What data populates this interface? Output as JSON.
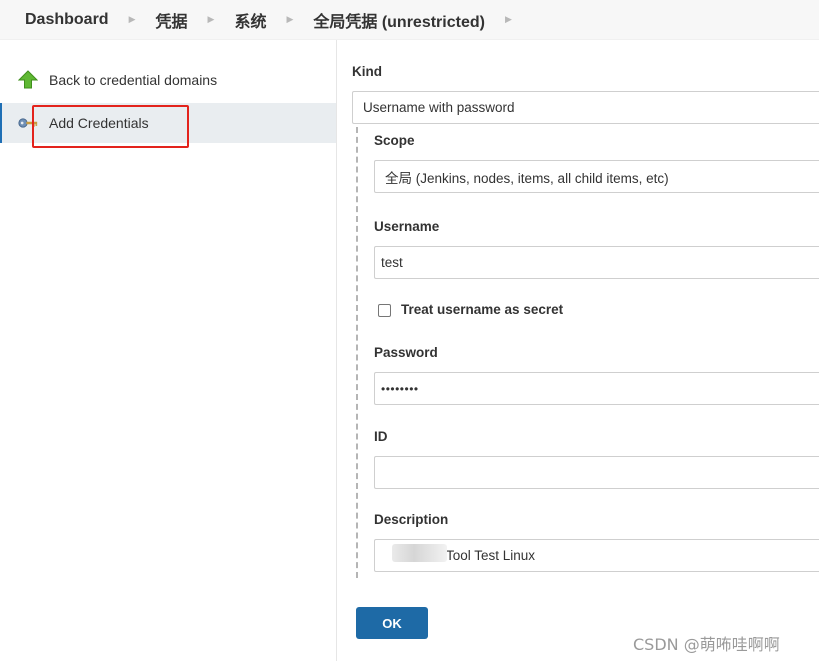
{
  "breadcrumb": {
    "items": [
      "Dashboard",
      "凭据",
      "系统",
      "全局凭据 (unrestricted)"
    ]
  },
  "sidebar": {
    "items": [
      {
        "label": "Back to credential domains",
        "icon": "green-up-arrow-icon"
      },
      {
        "label": "Add Credentials",
        "icon": "key-icon"
      }
    ]
  },
  "form": {
    "kind_label": "Kind",
    "kind_value": "Username with password",
    "scope_label": "Scope",
    "scope_value": "全局 (Jenkins, nodes, items, all child items, etc)",
    "username_label": "Username",
    "username_value": "test",
    "treat_secret_label": "Treat username as secret",
    "treat_secret_checked": false,
    "password_label": "Password",
    "password_value": "••••••••",
    "id_label": "ID",
    "id_value": "",
    "description_label": "Description",
    "description_value": "Tool Test Linux",
    "ok_label": "OK"
  },
  "watermark": "CSDN @萌咘哇啊啊",
  "colors": {
    "accent_button": "#1e6aa6",
    "active_item_bg": "#e9edf0",
    "highlight_box": "#e3231c"
  }
}
